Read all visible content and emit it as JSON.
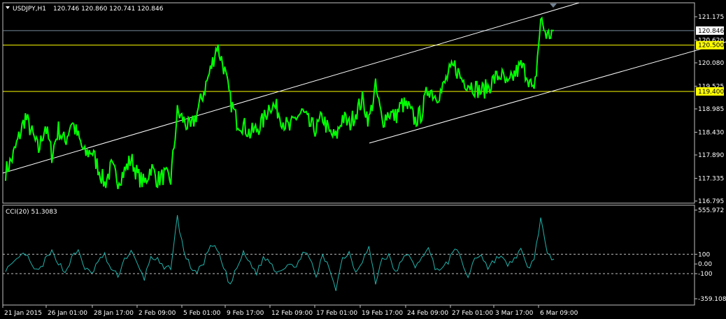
{
  "colors": {
    "background": "#000000",
    "frame": "#c0c0c0",
    "candles": "#00ff00",
    "cci": "#20b2aa",
    "horizontal_line": "#ffff00",
    "trendline": "#ffffff",
    "bid_line": "#778899",
    "text": "#ffffff"
  },
  "chart_data": [
    {
      "type": "line",
      "title": "USDJPY,H1",
      "ohlc_readout": [
        "120.746",
        "120.860",
        "120.741",
        "120.846"
      ],
      "price_labels": [
        "121.175",
        "120.846",
        "120.620",
        "120.500",
        "120.080",
        "119.525",
        "119.400",
        "118.985",
        "118.430",
        "117.890",
        "117.335",
        "116.795"
      ],
      "ylim": [
        116.795,
        121.175
      ],
      "x_tick_labels": [
        "21 Jan 2015",
        "26 Jan 01:00",
        "28 Jan 17:00",
        "2 Feb 09:00",
        "5 Feb 01:00",
        "9 Feb 17:00",
        "12 Feb 09:00",
        "17 Feb 01:00",
        "19 Feb 17:00",
        "24 Feb 09:00",
        "27 Feb 01:00",
        "3 Mar 17:00",
        "6 Mar 09:00"
      ],
      "current_price": 120.846,
      "horizontal_levels": [
        120.5,
        119.4
      ],
      "series": [
        {
          "values": [
            117.5,
            117.8,
            118.3,
            118.8,
            118.4,
            118.0,
            118.6,
            117.9,
            118.5,
            118.2,
            118.7,
            118.3,
            117.9,
            118.0,
            117.6,
            117.2,
            117.6,
            117.3,
            117.5,
            117.8,
            117.4,
            117.2,
            117.6,
            117.3,
            117.4,
            117.3,
            118.9,
            118.7,
            118.5,
            118.9,
            119.4,
            119.9,
            120.5,
            120.0,
            119.2,
            118.7,
            118.6,
            118.4,
            118.5,
            118.7,
            119.1,
            119.0,
            118.7,
            118.5,
            118.8,
            118.9,
            118.6,
            118.5,
            118.8,
            118.4,
            118.3,
            118.8,
            118.6,
            118.9,
            119.2,
            118.7,
            119.5,
            118.7,
            118.9,
            118.8,
            119.1,
            119.0,
            118.7,
            118.9,
            119.5,
            119.3,
            119.4,
            119.8,
            120.0,
            119.7,
            119.6,
            119.5,
            119.4,
            119.5,
            119.7,
            119.8,
            119.5,
            119.8,
            120.0,
            119.8,
            119.3,
            121.1,
            120.7,
            120.85
          ]
        }
      ]
    },
    {
      "type": "line",
      "title": "CCI(20) 51.3083",
      "price_labels": [
        "555.972",
        "100",
        "0.00",
        "-100",
        "-359.108"
      ],
      "ylim": [
        -359.108,
        555.972
      ],
      "levels": [
        100,
        -100
      ],
      "series": [
        {
          "values": [
            -50,
            -20,
            60,
            110,
            -30,
            -80,
            40,
            120,
            20,
            -90,
            60,
            140,
            -40,
            -110,
            30,
            90,
            -60,
            -120,
            50,
            130,
            -20,
            -150,
            80,
            40,
            -60,
            -30,
            480,
            120,
            -30,
            -90,
            20,
            180,
            150,
            -40,
            -220,
            -40,
            110,
            10,
            -90,
            60,
            30,
            -80,
            -40,
            20,
            -60,
            150,
            50,
            -130,
            80,
            -40,
            -250,
            60,
            120,
            -80,
            40,
            170,
            -200,
            60,
            80,
            -90,
            30,
            120,
            -60,
            90,
            150,
            -30,
            -60,
            20,
            180,
            30,
            -140,
            60,
            100,
            -40,
            40,
            90,
            -30,
            60,
            140,
            -50,
            50,
            480,
            80,
            51
          ]
        }
      ]
    }
  ]
}
